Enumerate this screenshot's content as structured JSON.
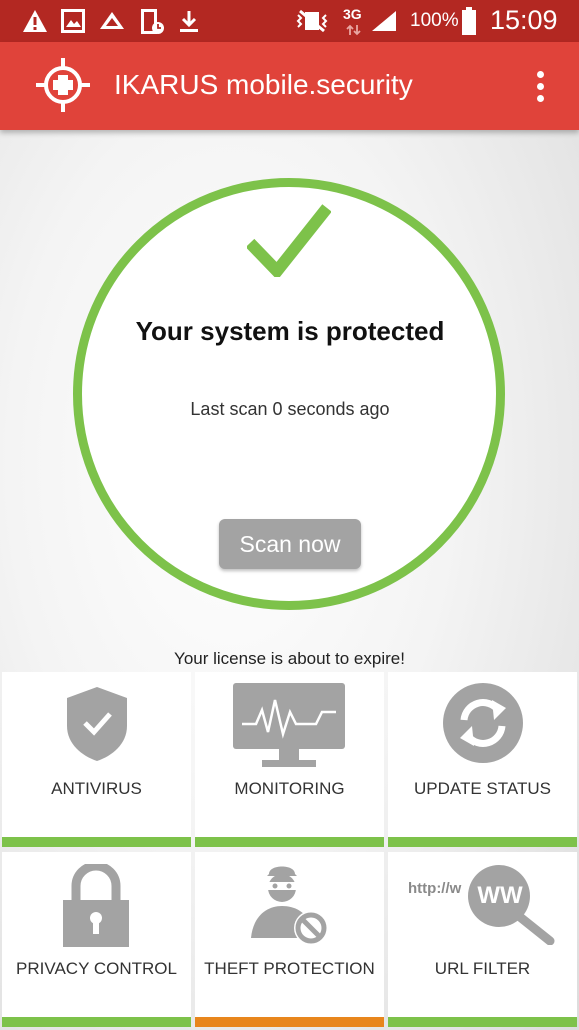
{
  "status_bar": {
    "network": "3G",
    "battery": "100%",
    "time": "15:09"
  },
  "app_bar": {
    "title": "IKARUS mobile.security"
  },
  "status": {
    "title": "Your system is protected",
    "last_scan": "Last scan 0 seconds ago",
    "scan_button": "Scan now",
    "license_message": "Your license is about to expire!"
  },
  "tiles": [
    {
      "label": "ANTIVIRUS",
      "icon": "shield-check-icon",
      "status_color": "#7dc24a"
    },
    {
      "label": "MONITORING",
      "icon": "monitor-pulse-icon",
      "status_color": "#7dc24a"
    },
    {
      "label": "UPDATE STATUS",
      "icon": "refresh-icon",
      "status_color": "#7dc24a"
    },
    {
      "label": "PRIVACY CONTROL",
      "icon": "padlock-icon",
      "status_color": "#7dc24a"
    },
    {
      "label": "THEFT PROTECTION",
      "icon": "thief-icon",
      "status_color": "#e8861c"
    },
    {
      "label": "URL FILTER",
      "icon": "url-magnifier-icon",
      "url_icon_text": "http://w",
      "url_icon_badge": "WW",
      "status_color": "#7dc24a"
    }
  ],
  "colors": {
    "status_bar": "#b32822",
    "app_bar": "#e0433a",
    "ok_green": "#7dc24a",
    "warning_orange": "#e8861c",
    "icon_grey": "#a3a3a3"
  }
}
